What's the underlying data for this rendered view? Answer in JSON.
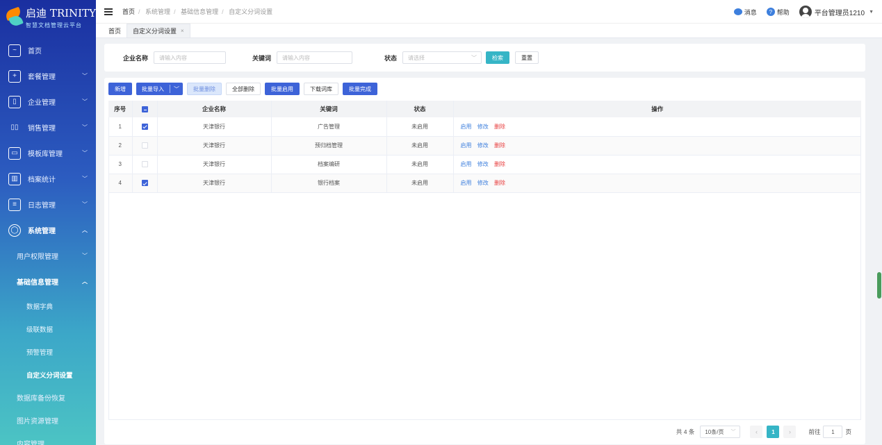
{
  "brand": {
    "title": "启迪 TRINITY",
    "subtitle": "智慧文档管理云平台"
  },
  "sidebar": {
    "items": [
      {
        "label": "首页",
        "icon": "chart-icon"
      },
      {
        "label": "套餐管理",
        "icon": "plus-box-icon"
      },
      {
        "label": "企业管理",
        "icon": "building-icon"
      },
      {
        "label": "销售管理",
        "icon": "bar-chart-icon"
      },
      {
        "label": "模板库管理",
        "icon": "template-icon"
      },
      {
        "label": "档案统计",
        "icon": "stats-icon"
      },
      {
        "label": "日志管理",
        "icon": "log-icon"
      },
      {
        "label": "系统管理",
        "icon": "gear-circle-icon"
      }
    ],
    "sub": {
      "user_perm": "用户权限管理",
      "basic_info": "基础信息管理",
      "dict": "数据字典",
      "level": "级联数据",
      "warning": "预警管理",
      "custom_seg": "自定义分词设置",
      "backup": "数据库备份恢复",
      "images": "图片资源管理",
      "content": "内容管理"
    }
  },
  "header": {
    "breadcrumb": [
      "首页",
      "系统管理",
      "基础信息管理",
      "自定义分词设置"
    ],
    "messages": "消息",
    "help": "帮助",
    "user": "平台管理员1210"
  },
  "tabs": [
    {
      "label": "首页"
    },
    {
      "label": "自定义分词设置",
      "close": "×"
    }
  ],
  "search": {
    "company_label": "企业名称",
    "company_placeholder": "请输入内容",
    "keyword_label": "关键词",
    "keyword_placeholder": "请输入内容",
    "status_label": "状态",
    "status_placeholder": "请选择",
    "search_btn": "检索",
    "reset_btn": "重置"
  },
  "toolbar": {
    "add": "新增",
    "batch_import": "批量导入",
    "batch_delete": "批量删除",
    "delete_all": "全部删除",
    "batch_enable": "批量启用",
    "download_lib": "下载词库",
    "batch_finish": "批量完成"
  },
  "table": {
    "headers": {
      "index": "序号",
      "company": "企业名称",
      "keyword": "关键词",
      "status": "状态",
      "ops": "操作"
    },
    "rows": [
      {
        "index": "1",
        "checked": true,
        "company": "天津银行",
        "keyword": "广告管理",
        "status": "未启用"
      },
      {
        "index": "2",
        "checked": false,
        "company": "天津银行",
        "keyword": "预归档管理",
        "status": "未启用"
      },
      {
        "index": "3",
        "checked": false,
        "company": "天津银行",
        "keyword": "档案编研",
        "status": "未启用"
      },
      {
        "index": "4",
        "checked": true,
        "company": "天津银行",
        "keyword": "银行档案",
        "status": "未启用"
      }
    ],
    "actions": {
      "enable": "启用",
      "edit": "修改",
      "delete": "删除"
    }
  },
  "pagination": {
    "total": "共 4 条",
    "page_size": "10条/页",
    "current": "1",
    "goto_prefix": "前往",
    "goto_value": "1",
    "goto_suffix": "页"
  }
}
